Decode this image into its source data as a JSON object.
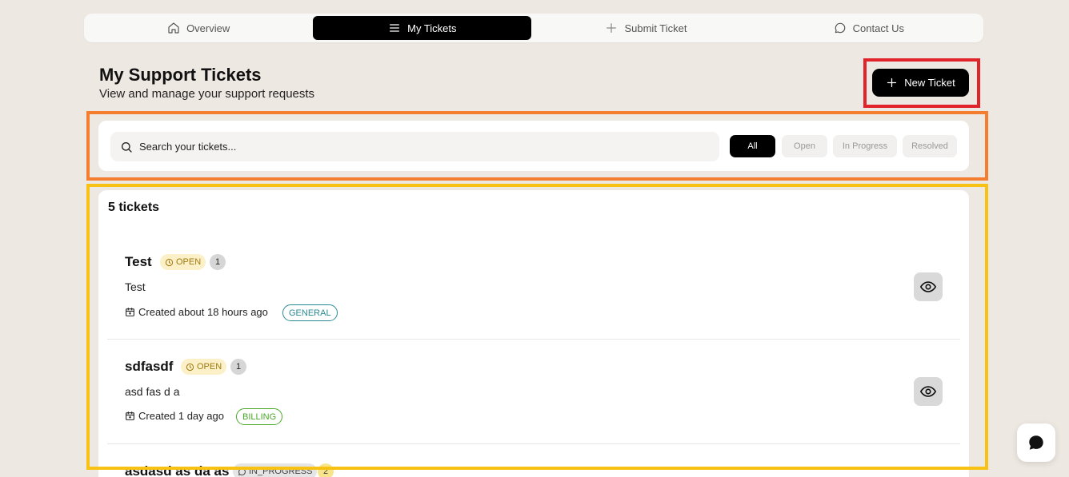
{
  "nav": {
    "tabs": [
      {
        "label": "Overview",
        "icon": "home-icon",
        "active": false
      },
      {
        "label": "My Tickets",
        "icon": "menu-icon",
        "active": true
      },
      {
        "label": "Submit Ticket",
        "icon": "plus-icon",
        "active": false
      },
      {
        "label": "Contact Us",
        "icon": "chat-bubble-icon",
        "active": false
      }
    ]
  },
  "header": {
    "title": "My Support Tickets",
    "subtitle": "View and manage your support requests",
    "new_ticket_label": "New Ticket"
  },
  "filters": {
    "search_placeholder": "Search your tickets...",
    "buttons": [
      "All",
      "Open",
      "In Progress",
      "Resolved"
    ],
    "active": "All"
  },
  "list": {
    "count_label": "5 tickets",
    "tickets": [
      {
        "title": "Test",
        "status": "OPEN",
        "messages": "1",
        "description": "Test",
        "created": "Created about 18 hours ago",
        "category": "GENERAL"
      },
      {
        "title": "sdfasdf",
        "status": "OPEN",
        "messages": "1",
        "description": "asd fas d a",
        "created": "Created 1 day ago",
        "category": "BILLING"
      },
      {
        "title": "asdasd as da as",
        "status": "IN_PROGRESS",
        "messages": "2"
      }
    ]
  },
  "colors": {
    "accent": "#000000",
    "background": "#eee8e2",
    "highlight_red": "#e1242a",
    "highlight_orange": "#f47d2f",
    "highlight_yellow": "#f8c214",
    "status_open": "#fbf0c8",
    "category_general": "#2a8a94",
    "category_billing": "#4aa82a"
  }
}
